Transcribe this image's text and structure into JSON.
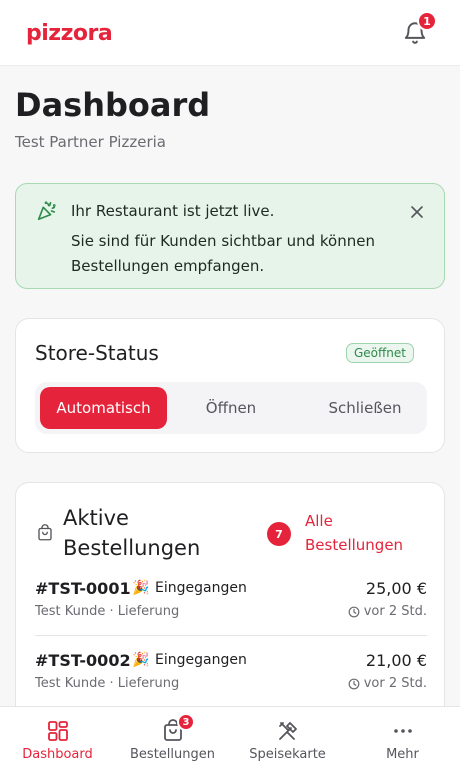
{
  "app": {
    "logo": "pizzora",
    "notification_count": "1"
  },
  "header": {
    "title": "Dashboard",
    "subtitle": "Test Partner Pizzeria"
  },
  "live_banner": {
    "title": "Ihr Restaurant ist jetzt live.",
    "text": "Sie sind für Kunden sichtbar und können Bestellungen empfangen."
  },
  "store_status": {
    "title": "Store-Status",
    "badge": "Geöffnet",
    "options": [
      "Automatisch",
      "Öffnen",
      "Schließen"
    ],
    "selected": "Automatisch"
  },
  "orders": {
    "title": "Aktive Bestellungen",
    "count": "7",
    "all_link": "Alle Bestellungen",
    "items": [
      {
        "id": "#TST-0001",
        "emoji": "🎉",
        "status": "Eingegangen",
        "customer": "Test Kunde · Lieferung",
        "price": "25,00 €",
        "time": "vor 2 Std."
      },
      {
        "id": "#TST-0002",
        "emoji": "🎉",
        "status": "Eingegangen",
        "customer": "Test Kunde · Lieferung",
        "price": "21,00 €",
        "time": "vor 2 Std."
      }
    ]
  },
  "tabbar": {
    "items": [
      {
        "label": "Dashboard",
        "icon": "grid-icon",
        "active": true
      },
      {
        "label": "Bestellungen",
        "icon": "bag-icon",
        "badge": "3"
      },
      {
        "label": "Speisekarte",
        "icon": "utensils-icon"
      },
      {
        "label": "Mehr",
        "icon": "more-dots-icon"
      }
    ]
  },
  "colors": {
    "accent": "#e5243b",
    "success_bg": "#e6f4ea",
    "success_border": "#a9d9b5",
    "success_text": "#2f8a4a"
  }
}
